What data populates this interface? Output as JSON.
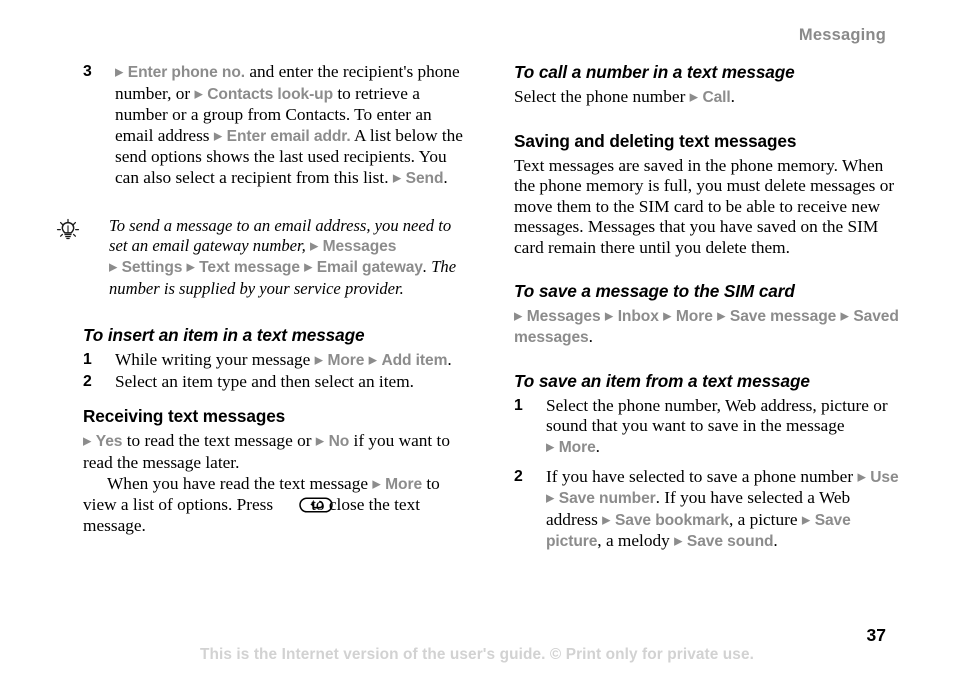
{
  "header": {
    "chapter": "Messaging"
  },
  "footer": {
    "note": "This is the Internet version of the user's guide. © Print only for private use.",
    "page_number": "37"
  },
  "icons": {
    "tip": "lightbulb-icon",
    "back_key": "back-key-icon"
  },
  "colors": {
    "ui_grey": "#8c8c8c",
    "header_grey": "#8a8a8a",
    "footer_grey": "#d2d2d2",
    "text": "#000000"
  },
  "left_column": {
    "step3": {
      "number": "3",
      "t1": "and enter the recipient's phone number, or",
      "ui1": "Enter phone no.",
      "ui2": "Contacts look-up",
      "t2": "to retrieve a number or a group from Contacts. To enter an email address",
      "ui3": "Enter email addr.",
      "t3": "A list below the send options shows the last used recipients. You can also select a recipient from this list.",
      "ui4": "Send",
      "t4": "."
    },
    "tip": {
      "t1": "To send a message to an email address, you need to set an email gateway number,",
      "ui1": "Messages",
      "ui2": "Settings",
      "ui3": "Text message",
      "ui4": "Email gateway",
      "t2": ".",
      "t3": "The number is supplied by your service provider."
    },
    "insert_item": {
      "heading": "To insert an item in a text message",
      "step1": {
        "number": "1",
        "t1": "While writing your message",
        "ui1": "More",
        "ui2": "Add item",
        "t2": "."
      },
      "step2": {
        "number": "2",
        "t1": "Select an item type and then select an item."
      }
    },
    "receiving": {
      "heading": "Receiving text messages",
      "ui1": "Yes",
      "t1": "to read the text message or",
      "ui2": "No",
      "t2": "if you want to read the message later.",
      "t3": "When you have read the text message",
      "ui3": "More",
      "t4": "to view a list of options. Press",
      "t5": "to close the text message."
    }
  },
  "right_column": {
    "call_number": {
      "heading": "To call a number in a text message",
      "t1": "Select the phone number",
      "ui1": "Call",
      "t2": "."
    },
    "saving_deleting": {
      "heading": "Saving and deleting text messages",
      "body": "Text messages are saved in the phone memory. When the phone memory is full, you must delete messages or move them to the SIM card to be able to receive new messages. Messages that you have saved on the SIM card remain there until you delete them."
    },
    "save_to_sim": {
      "heading": "To save a message to the SIM card",
      "ui1": "Messages",
      "ui2": "Inbox",
      "ui3": "More",
      "ui4": "Save message",
      "ui5": "Saved messages",
      "t1": "."
    },
    "save_item": {
      "heading": "To save an item from a text message",
      "step1": {
        "number": "1",
        "t1": "Select the phone number, Web address, picture or sound that you want to save in the message",
        "ui1": "More",
        "t2": "."
      },
      "step2": {
        "number": "2",
        "t1": "If you have selected to save a phone number",
        "ui1": "Use",
        "ui2": "Save number",
        "t2": ". If you have selected a Web address",
        "ui3": "Save bookmark",
        "t3": ", a picture",
        "ui4": "Save picture",
        "t4": ", a melody",
        "ui5": "Save sound",
        "t5": "."
      }
    }
  }
}
